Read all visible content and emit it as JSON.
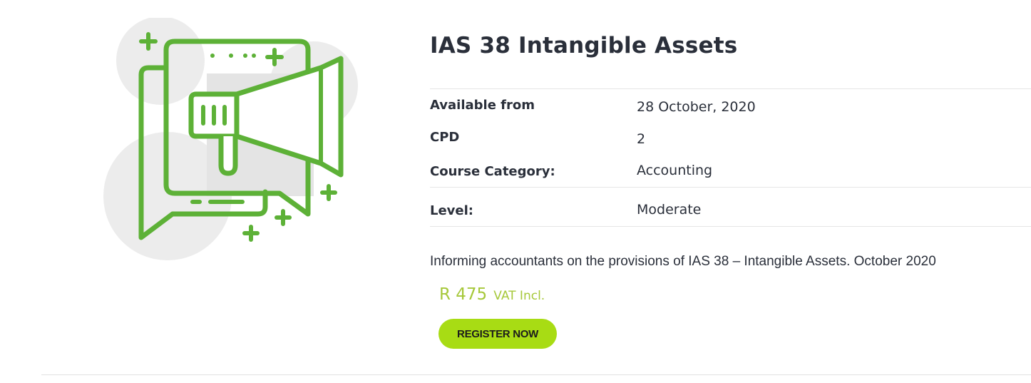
{
  "course": {
    "title": "IAS 38 Intangible Assets",
    "icon": "megaphone-chat-icon",
    "details": {
      "available_from_label": "Available from",
      "available_from_value": "28 October, 2020",
      "cpd_label": "CPD",
      "cpd_value": "2",
      "category_label": "Course Category:",
      "category_value": "Accounting",
      "level_label": "Level:",
      "level_value": "Moderate"
    },
    "description": "Informing accountants on the provisions of IAS 38 – Intangible Assets. October 2020",
    "price": {
      "amount": "R 475",
      "suffix": "VAT Incl."
    },
    "register_label": "REGISTER NOW"
  },
  "colors": {
    "accent_green": "#5db137",
    "price_green": "#a6c83a",
    "button_green": "#a8dc14",
    "text_dark": "#2a2f3a"
  }
}
